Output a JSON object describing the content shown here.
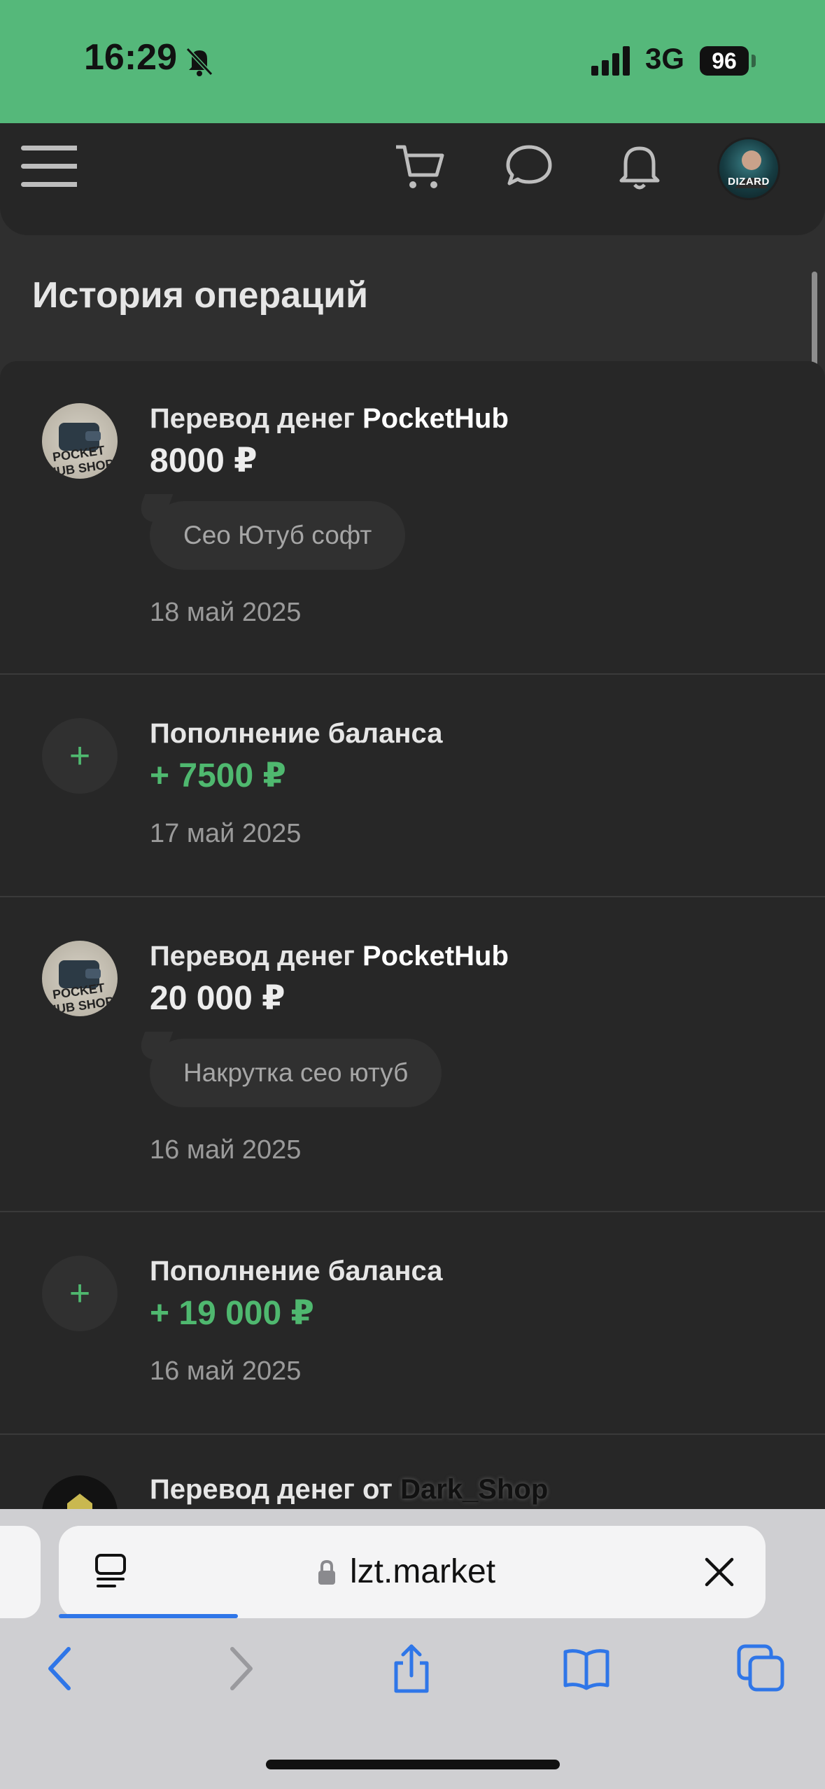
{
  "status_bar": {
    "time": "16:29",
    "network": "3G",
    "battery": "96",
    "icons": [
      "bell-off-icon",
      "signal-icon"
    ]
  },
  "nav": {
    "icons": [
      "menu-icon",
      "cart-icon",
      "chat-icon",
      "bell-icon"
    ],
    "avatar_label": "DIZARD"
  },
  "page": {
    "title": "История операций"
  },
  "operations": [
    {
      "icon": "wallet-icon",
      "icon_text": "POCKET HUB SHOP",
      "title_prefix": "Перевод денег ",
      "title_brand": "PocketHub",
      "amount": "8000 ₽",
      "comment": "Сео Ютуб софт",
      "date": "18 май 2025"
    },
    {
      "icon": "plus-icon",
      "icon_glyph": "+",
      "title": "Пополнение баланса",
      "amount": "+ 7500 ₽",
      "date": "17 май 2025"
    },
    {
      "icon": "wallet-icon",
      "icon_text": "POCKET HUB SHOP",
      "title_prefix": "Перевод денег ",
      "title_brand": "PocketHub",
      "amount": "20 000 ₽",
      "comment": "Накрутка сео ютуб",
      "date": "16 май 2025"
    },
    {
      "icon": "plus-icon",
      "icon_glyph": "+",
      "title": "Пополнение баланса",
      "amount": "+ 19 000 ₽",
      "date": "16 май 2025"
    },
    {
      "icon": "shop-icon",
      "title_prefix": "Перевод денег от ",
      "title_brand": "Dark_Shop"
    }
  ],
  "browser": {
    "url": "lzt.market",
    "icons": [
      "tab-overview-icon",
      "lock-icon",
      "close-icon",
      "back-icon",
      "forward-icon",
      "share-icon",
      "bookmarks-icon",
      "tabs-icon"
    ]
  },
  "colors": {
    "status_bar_bg": "#55b87a",
    "page_bg": "#2f2f2f",
    "card_bg": "#272727",
    "accent_green": "#4fb86f",
    "link_blue": "#2f76e8"
  }
}
